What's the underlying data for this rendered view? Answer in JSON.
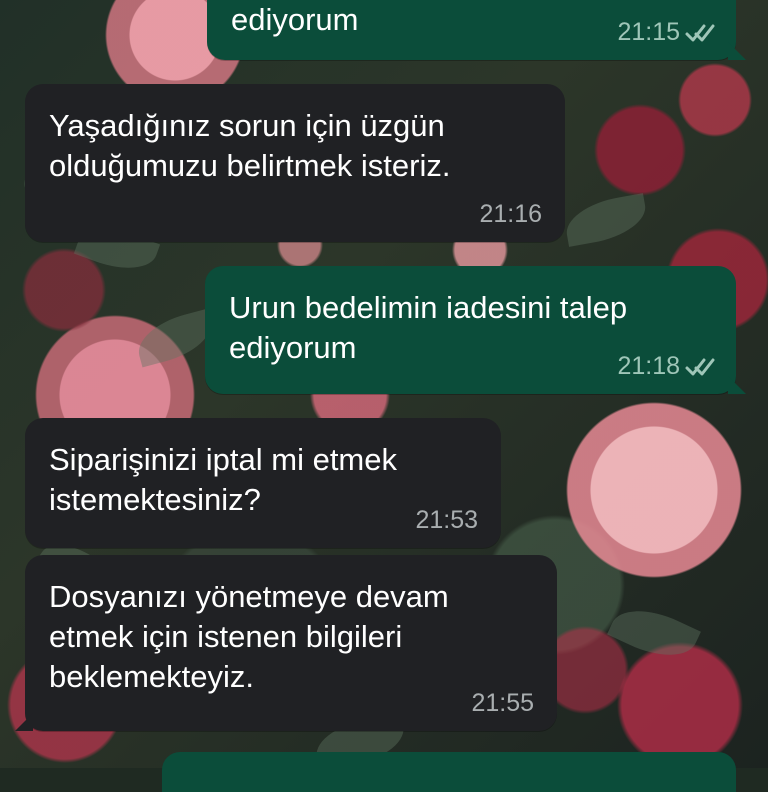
{
  "chat": {
    "messages": [
      {
        "direction": "outgoing",
        "text": "ediyorum",
        "time": "21:15",
        "status_icon": "double-check-icon"
      },
      {
        "direction": "incoming",
        "text": "Yaşadığınız sorun için üzgün\nolduğumuzu belirtmek isteriz.",
        "time": "21:16"
      },
      {
        "direction": "outgoing",
        "text": "Urun bedelimin iadesini talep\nediyorum",
        "time": "21:18",
        "status_icon": "double-check-icon"
      },
      {
        "direction": "incoming",
        "text": "Siparişinizi iptal mi etmek\nistemektesiniz?",
        "time": "21:53"
      },
      {
        "direction": "incoming",
        "text": "Dosyanızı yönetmeye devam\netmek için istenen bilgileri\nbeklemekteyiz.",
        "time": "21:55"
      }
    ]
  },
  "colors": {
    "incoming_bubble": "#202124",
    "outgoing_bubble": "#0b4d3a",
    "message_text": "#ffffff",
    "time_incoming": "#a9aeb0",
    "time_outgoing": "#9fc6b8"
  }
}
